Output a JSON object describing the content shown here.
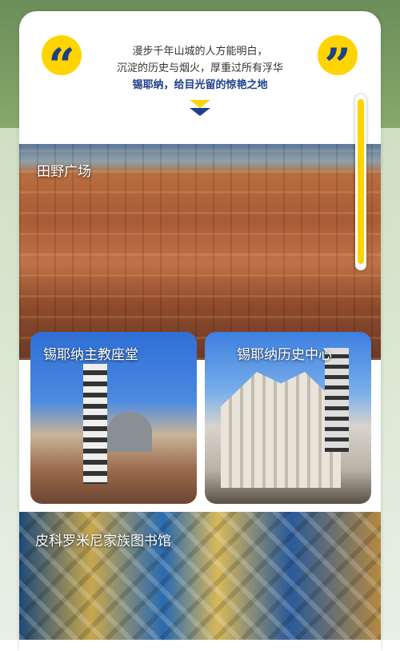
{
  "intro": {
    "line1": "漫步千年山城的人方能明白，",
    "line2": "沉淀的历史与烟火，厚重过所有浮华",
    "highlight": "锡耶纳，给目光留的惊艳之地"
  },
  "quotes": {
    "open": "“",
    "close": "”"
  },
  "photos": {
    "main_label": "田野广场",
    "left_label": "锡耶纳主教座堂",
    "right_label": "锡耶纳历史中心",
    "bottom_label": "皮科罗米尼家族图书馆"
  },
  "colors": {
    "accent": "#ffd400",
    "brand": "#1c3f8a"
  }
}
